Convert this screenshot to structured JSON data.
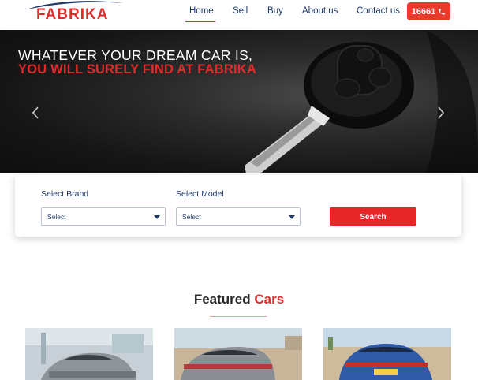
{
  "brand": {
    "name": "FABRIKA",
    "color": "#e02b2b"
  },
  "nav": {
    "items": [
      {
        "label": "Home",
        "active": true
      },
      {
        "label": "Sell",
        "active": false
      },
      {
        "label": "Buy",
        "active": false
      },
      {
        "label": "About us",
        "active": false
      },
      {
        "label": "Contact us",
        "active": false
      }
    ],
    "phone": {
      "label": "16661",
      "icon": "phone-icon"
    }
  },
  "hero": {
    "line1": "WHATEVER YOUR DREAM CAR IS,",
    "line2": "YOU WILL SURELY FIND AT FABRIKA",
    "prev_icon": "chevron-left-icon",
    "next_icon": "chevron-right-icon"
  },
  "search": {
    "brand_label": "Select Brand",
    "brand_value": "Select",
    "model_label": "Select Model",
    "model_value": "Select",
    "button_label": "Search"
  },
  "featured": {
    "title_part1": "Featured",
    "title_part2": "Cars"
  },
  "colors": {
    "accent": "#e02b2b",
    "navy": "#1f3a6a"
  }
}
